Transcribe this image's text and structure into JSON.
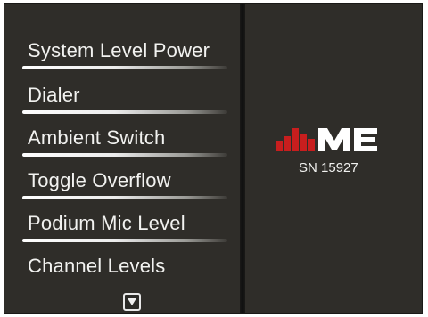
{
  "menu": {
    "items": [
      {
        "label": "System Level Power"
      },
      {
        "label": "Dialer"
      },
      {
        "label": "Ambient Switch"
      },
      {
        "label": "Toggle Overflow"
      },
      {
        "label": "Podium Mic Level"
      },
      {
        "label": "Channel Levels"
      }
    ]
  },
  "device": {
    "logo_text": "ME",
    "serial": "SN 15927"
  },
  "colors": {
    "background": "#2f2d29",
    "text": "#f2f2f0",
    "logo_red": "#c81e1e",
    "logo_white": "#ffffff"
  },
  "icons": {
    "scroll_down": "triangle-down-icon"
  }
}
